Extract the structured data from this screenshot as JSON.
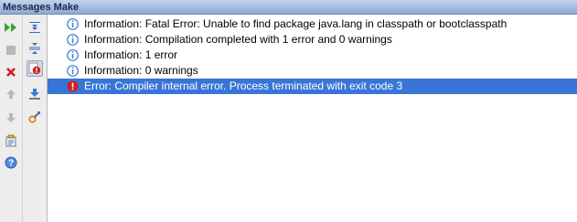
{
  "window": {
    "title": "Messages Make"
  },
  "toolbar": {
    "left_buttons": [
      {
        "name": "rerun-icon"
      },
      {
        "name": "stop-icon"
      },
      {
        "name": "close-icon"
      },
      {
        "name": "previous-icon"
      },
      {
        "name": "next-icon"
      },
      {
        "name": "export-icon"
      },
      {
        "name": "help-icon"
      }
    ],
    "right_buttons": [
      {
        "name": "expand-all-icon"
      },
      {
        "name": "collapse-all-icon"
      },
      {
        "name": "filter-errors-icon",
        "pressed": true
      },
      {
        "name": "autoscroll-icon"
      },
      {
        "name": "settings-icon"
      }
    ]
  },
  "messages": [
    {
      "type": "info",
      "icon": "info-icon",
      "text": "Information: Fatal Error: Unable to find package java.lang in classpath or bootclasspath"
    },
    {
      "type": "info",
      "icon": "info-icon",
      "text": "Information: Compilation completed with 1 error and 0 warnings"
    },
    {
      "type": "info",
      "icon": "info-icon",
      "text": "Information: 1 error"
    },
    {
      "type": "info",
      "icon": "info-icon",
      "text": "Information: 0 warnings"
    },
    {
      "type": "error",
      "icon": "error-icon",
      "text": "Error: Compiler internal error. Process terminated with exit code 3",
      "selected": true
    }
  ],
  "colors": {
    "selection": "#3875d7",
    "info": "#3b7dd8",
    "error": "#d21e1e"
  }
}
